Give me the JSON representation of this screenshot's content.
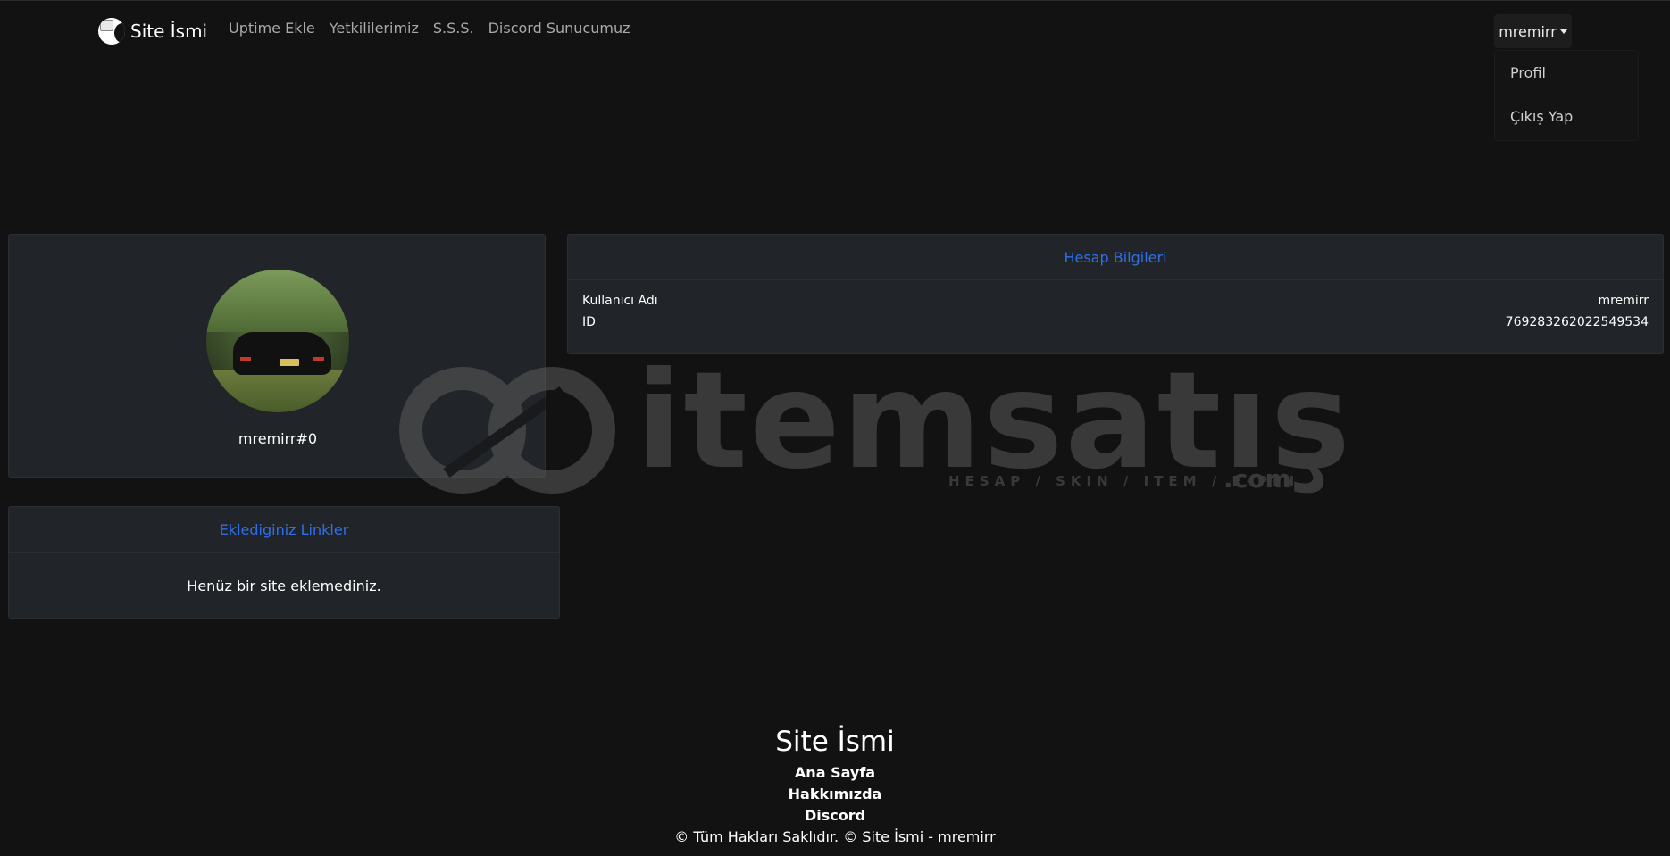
{
  "navbar": {
    "brand": "Site İsmi",
    "links": [
      "Uptime Ekle",
      "Yetkililerimiz",
      "S.S.S.",
      "Discord Sunucumuz"
    ],
    "user": "mremirr",
    "dropdown": [
      "Profil",
      "Çıkış Yap"
    ]
  },
  "profile": {
    "display_name": "mremirr#0"
  },
  "links_card": {
    "title": "Eklediginiz Linkler",
    "empty_message": "Henüz bir site eklemediniz."
  },
  "account": {
    "title": "Hesap Bilgileri",
    "rows": [
      {
        "label": "Kullanıcı Adı",
        "value": "mremirr"
      },
      {
        "label": "ID",
        "value": "769283262022549534"
      }
    ]
  },
  "watermark": {
    "brand": "itemsatış",
    "tagline": "HESAP / SKIN / ITEM / E-PIN",
    "suffix": ".com"
  },
  "footer": {
    "title": "Site İsmi",
    "links": [
      "Ana Sayfa",
      "Hakkımızda",
      "Discord"
    ],
    "copyright": "© Tüm Hakları Saklıdır. © Site İsmi - mremirr"
  },
  "colors": {
    "background": "#121212",
    "card": "#212529",
    "accent": "#2f6fe8"
  }
}
